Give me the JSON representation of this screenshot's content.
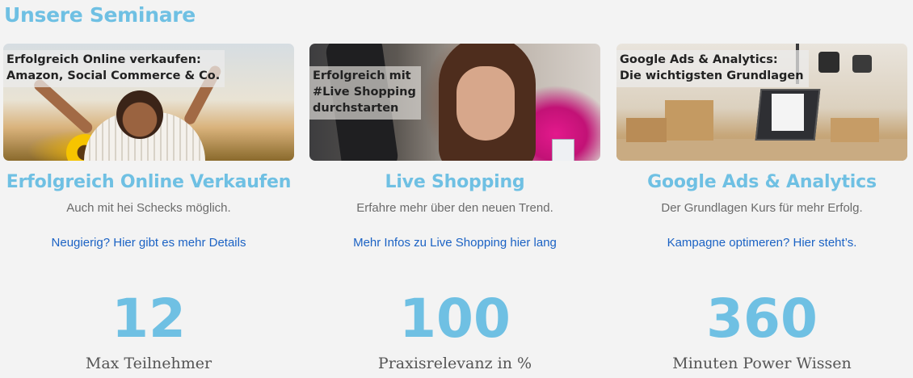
{
  "section": {
    "title": "Unsere Seminare"
  },
  "cards": [
    {
      "banner_text": "Erfolgreich Online verkaufen:\nAmazon, Social Commerce & Co.",
      "title": "Erfolgreich Online Verkaufen",
      "subtitle": "Auch mit hei Schecks möglich.",
      "link": "Neugierig? Hier gibt es mehr Details",
      "stat_number": "12",
      "stat_label": "Max Teilnehmer"
    },
    {
      "banner_text": "Erfolgreich mit\n#Live Shopping\ndurchstarten",
      "title": "Live Shopping",
      "subtitle": "Erfahre mehr über den neuen Trend.",
      "link": "Mehr Infos zu Live Shopping hier lang",
      "stat_number": "100",
      "stat_label": "Praxisrelevanz in %"
    },
    {
      "banner_text": "Google Ads & Analytics:\nDie wichtigsten Grundlagen",
      "title": "Google Ads & Analytics",
      "subtitle": "Der Grundlagen Kurs für mehr Erfolg.",
      "link": "Kampagne optimeren? Hier steht’s.",
      "stat_number": "360",
      "stat_label": "Minuten Power Wissen"
    }
  ],
  "colors": {
    "accent": "#6fc0e3",
    "link": "#1b62c4",
    "background": "#f3f3f3"
  }
}
